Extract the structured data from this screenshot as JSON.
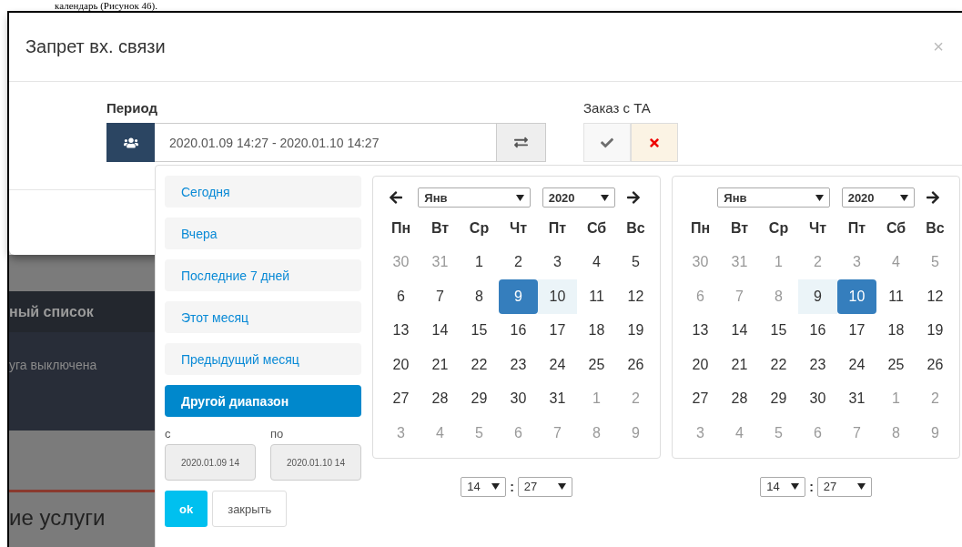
{
  "caption": "календарь (Рисунок 46).",
  "dialog": {
    "title": "Запрет вх. связи",
    "close": "×",
    "period": {
      "label": "Период",
      "value": "2020.01.09 14:27 - 2020.01.10 14:27"
    },
    "order": {
      "label": "Заказ с ТА",
      "options": [
        {
          "kind": "yes",
          "selected": false
        },
        {
          "kind": "no",
          "selected": true
        }
      ]
    }
  },
  "background": {
    "items": [
      {
        "kind": "header",
        "text": "ный список"
      },
      {
        "kind": "row",
        "text": "уга выключена"
      },
      {
        "kind": "section",
        "text": "ие услуги"
      }
    ]
  },
  "datepicker": {
    "ranges": [
      {
        "label": "Сегодня",
        "selected": false
      },
      {
        "label": "Вчера",
        "selected": false
      },
      {
        "label": "Последние 7 дней",
        "selected": false
      },
      {
        "label": "Этот месяц",
        "selected": false
      },
      {
        "label": "Предыдущий месяц",
        "selected": false
      },
      {
        "label": "Другой диапазон",
        "selected": true
      }
    ],
    "from": {
      "label": "с",
      "value": "2020.01.09 14"
    },
    "to": {
      "label": "по",
      "value": "2020.01.10 14"
    },
    "buttons": [
      {
        "kind": "primary",
        "label": "ok"
      },
      {
        "kind": "default",
        "label": "закрыть"
      }
    ],
    "calendars": [
      {
        "prev": true,
        "next": true,
        "month": "Янв",
        "year": "2020",
        "hour": "14",
        "separator": ":",
        "minute": "27",
        "weekdays": [
          "Пн",
          "Вт",
          "Ср",
          "Чт",
          "Пт",
          "Сб",
          "Вс"
        ],
        "weeks": [
          [
            {
              "d": "30",
              "muted": true
            },
            {
              "d": "31",
              "muted": true
            },
            {
              "d": "1"
            },
            {
              "d": "2"
            },
            {
              "d": "3"
            },
            {
              "d": "4"
            },
            {
              "d": "5"
            }
          ],
          [
            {
              "d": "6"
            },
            {
              "d": "7"
            },
            {
              "d": "8"
            },
            {
              "d": "9",
              "selected": true
            },
            {
              "d": "10",
              "in_range": true
            },
            {
              "d": "11"
            },
            {
              "d": "12"
            }
          ],
          [
            {
              "d": "13"
            },
            {
              "d": "14"
            },
            {
              "d": "15"
            },
            {
              "d": "16"
            },
            {
              "d": "17"
            },
            {
              "d": "18"
            },
            {
              "d": "19"
            }
          ],
          [
            {
              "d": "20"
            },
            {
              "d": "21"
            },
            {
              "d": "22"
            },
            {
              "d": "23"
            },
            {
              "d": "24"
            },
            {
              "d": "25"
            },
            {
              "d": "26"
            }
          ],
          [
            {
              "d": "27"
            },
            {
              "d": "28"
            },
            {
              "d": "29"
            },
            {
              "d": "30"
            },
            {
              "d": "31"
            },
            {
              "d": "1",
              "muted": true
            },
            {
              "d": "2",
              "muted": true
            }
          ],
          [
            {
              "d": "3",
              "muted": true
            },
            {
              "d": "4",
              "muted": true
            },
            {
              "d": "5",
              "muted": true
            },
            {
              "d": "6",
              "muted": true
            },
            {
              "d": "7",
              "muted": true
            },
            {
              "d": "8",
              "muted": true
            },
            {
              "d": "9",
              "muted": true
            }
          ]
        ]
      },
      {
        "prev": false,
        "next": true,
        "month": "Янв",
        "year": "2020",
        "hour": "14",
        "separator": ":",
        "minute": "27",
        "weekdays": [
          "Пн",
          "Вт",
          "Ср",
          "Чт",
          "Пт",
          "Сб",
          "Вс"
        ],
        "weeks": [
          [
            {
              "d": "30",
              "muted": true
            },
            {
              "d": "31",
              "muted": true
            },
            {
              "d": "1",
              "muted": true
            },
            {
              "d": "2",
              "muted": true
            },
            {
              "d": "3",
              "muted": true
            },
            {
              "d": "4",
              "muted": true
            },
            {
              "d": "5",
              "muted": true
            }
          ],
          [
            {
              "d": "6",
              "muted": true
            },
            {
              "d": "7",
              "muted": true
            },
            {
              "d": "8",
              "muted": true
            },
            {
              "d": "9",
              "in_range": true
            },
            {
              "d": "10",
              "selected": true
            },
            {
              "d": "11"
            },
            {
              "d": "12"
            }
          ],
          [
            {
              "d": "13"
            },
            {
              "d": "14"
            },
            {
              "d": "15"
            },
            {
              "d": "16"
            },
            {
              "d": "17"
            },
            {
              "d": "18"
            },
            {
              "d": "19"
            }
          ],
          [
            {
              "d": "20"
            },
            {
              "d": "21"
            },
            {
              "d": "22"
            },
            {
              "d": "23"
            },
            {
              "d": "24"
            },
            {
              "d": "25"
            },
            {
              "d": "26"
            }
          ],
          [
            {
              "d": "27"
            },
            {
              "d": "28"
            },
            {
              "d": "29"
            },
            {
              "d": "30"
            },
            {
              "d": "31"
            },
            {
              "d": "1",
              "muted": true
            },
            {
              "d": "2",
              "muted": true
            }
          ],
          [
            {
              "d": "3",
              "muted": true
            },
            {
              "d": "4",
              "muted": true
            },
            {
              "d": "5",
              "muted": true
            },
            {
              "d": "6",
              "muted": true
            },
            {
              "d": "7",
              "muted": true
            },
            {
              "d": "8",
              "muted": true
            },
            {
              "d": "9",
              "muted": true
            }
          ]
        ]
      }
    ]
  }
}
